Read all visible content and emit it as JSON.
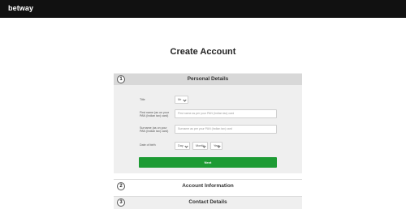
{
  "header": {
    "logo": "betway"
  },
  "page": {
    "title": "Create Account"
  },
  "sections": [
    {
      "number": "1",
      "label": "Personal Details"
    },
    {
      "number": "2",
      "label": "Account Information"
    },
    {
      "number": "3",
      "label": "Contact Details"
    }
  ],
  "form": {
    "title_label": "Title",
    "title_value": "Mr",
    "first_name_label": "First name (as on your PAN (Indian tax) card)",
    "first_name_placeholder": "First name as per your PAN (Indian tax) card",
    "surname_label": "Surname (as on your PAN (Indian tax) card)",
    "surname_placeholder": "Surname as per your PAN (Indian tax) card",
    "dob_label": "Date of birth",
    "dob_day": "Day",
    "dob_month": "Month",
    "dob_year": "Year",
    "next_label": "Next"
  },
  "colors": {
    "topbar": "#111111",
    "accent_green": "#1d9b34"
  }
}
